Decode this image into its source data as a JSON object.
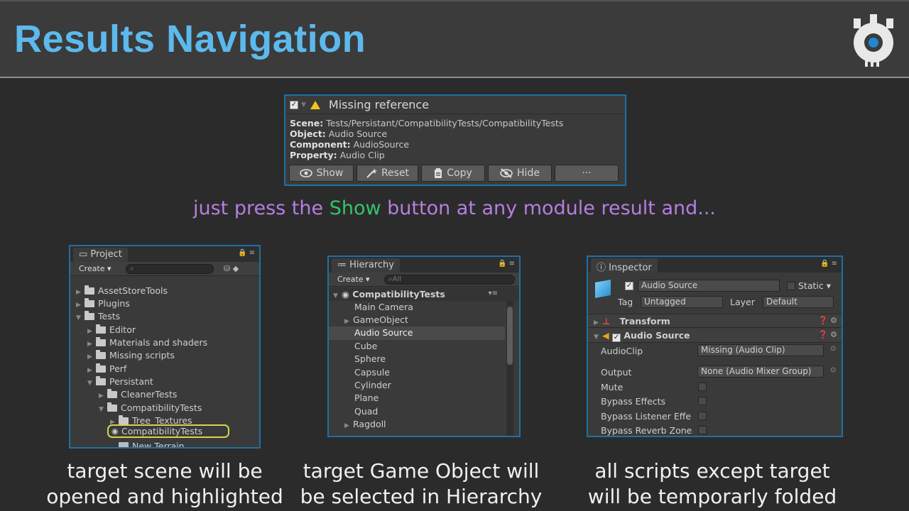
{
  "slide": {
    "title": "Results Navigation",
    "tagline_pre": "just press the ",
    "tagline_show": "Show",
    "tagline_post": " button at any module result and...",
    "colors": {
      "title": "#5cb9ec",
      "tagline": "#b57ee0",
      "show": "#32c56a",
      "accent_border": "#1f6fa6"
    }
  },
  "card": {
    "title": "Missing reference",
    "scene_label": "Scene:",
    "scene_value": "Tests/Persistant/CompatibilityTests/CompatibilityTests",
    "object_label": "Object:",
    "object_value": "Audio Source",
    "component_label": "Component:",
    "component_value": "AudioSource",
    "property_label": "Property:",
    "property_value": "Audio Clip",
    "buttons": {
      "show": "Show",
      "reset": "Reset",
      "copy": "Copy",
      "hide": "Hide",
      "more": "···"
    }
  },
  "project": {
    "tab": "Project",
    "create": "Create",
    "items": [
      "AssetStoreTools",
      "Plugins",
      "Tests",
      "Editor",
      "Materials and shaders",
      "Missing scripts",
      "Perf",
      "Persistant",
      "CleanerTests",
      "CompatibilityTests",
      "Tree_Textures",
      "CompatibilityTests",
      "New Terrain"
    ],
    "caption_line1": "target scene will be",
    "caption_line2": "opened and highlighted"
  },
  "hierarchy": {
    "tab": "Hierarchy",
    "create": "Create",
    "search": "All",
    "scene": "CompatibilityTests",
    "items": [
      "Main Camera",
      "GameObject",
      "Audio Source",
      "Cube",
      "Sphere",
      "Capsule",
      "Cylinder",
      "Plane",
      "Quad",
      "Ragdoll"
    ],
    "caption_line1": "target Game Object will",
    "caption_line2": "be selected in Hierarchy"
  },
  "inspector": {
    "tab": "Inspector",
    "name": "Audio Source",
    "static": "Static",
    "tag_label": "Tag",
    "tag_value": "Untagged",
    "layer_label": "Layer",
    "layer_value": "Default",
    "transform": "Transform",
    "audio_source": "Audio Source",
    "audioclip_label": "AudioClip",
    "audioclip_value": "Missing (Audio Clip)",
    "output_label": "Output",
    "output_value": "None (Audio Mixer Group)",
    "mute_label": "Mute",
    "bypass_effects_label": "Bypass Effects",
    "bypass_listener_label": "Bypass Listener Effe",
    "bypass_reverb_label": "Bypass Reverb Zone",
    "caption_line1": "all scripts except target",
    "caption_line2": "will be temporarly folded"
  }
}
